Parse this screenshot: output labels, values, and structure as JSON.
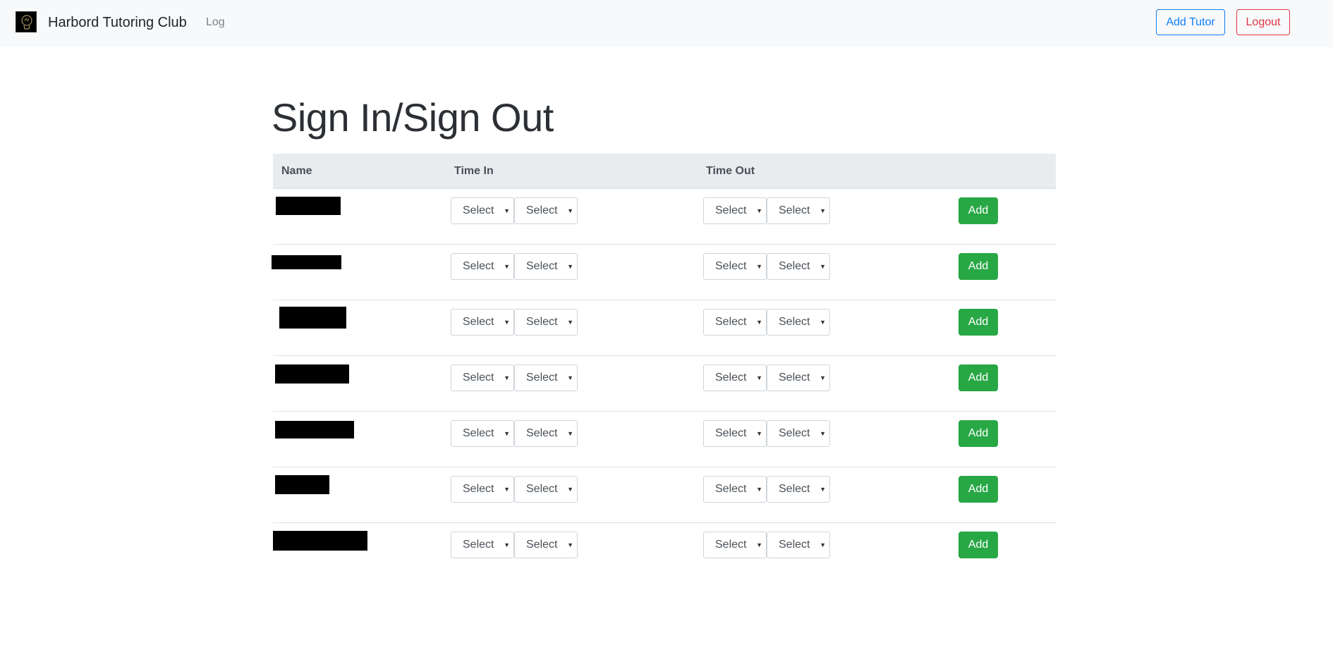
{
  "navbar": {
    "brand_name": "Harbord Tutoring Club",
    "log_link": "Log",
    "add_tutor_label": "Add Tutor",
    "logout_label": "Logout"
  },
  "page": {
    "title": "Sign In/Sign Out"
  },
  "table": {
    "headers": {
      "name": "Name",
      "time_in": "Time In",
      "time_out": "Time Out"
    },
    "rows": [
      {
        "name": "",
        "time_in_hour": "Select",
        "time_in_minute": "Select",
        "time_out_hour": "Select",
        "time_out_minute": "Select",
        "action": "Add"
      },
      {
        "name": "",
        "time_in_hour": "Select",
        "time_in_minute": "Select",
        "time_out_hour": "Select",
        "time_out_minute": "Select",
        "action": "Add"
      },
      {
        "name": "",
        "time_in_hour": "Select",
        "time_in_minute": "Select",
        "time_out_hour": "Select",
        "time_out_minute": "Select",
        "action": "Add"
      },
      {
        "name": "",
        "time_in_hour": "Select",
        "time_in_minute": "Select",
        "time_out_hour": "Select",
        "time_out_minute": "Select",
        "action": "Add"
      },
      {
        "name": "",
        "time_in_hour": "Select",
        "time_in_minute": "Select",
        "time_out_hour": "Select",
        "time_out_minute": "Select",
        "action": "Add"
      },
      {
        "name": "",
        "time_in_hour": "Select",
        "time_in_minute": "Select",
        "time_out_hour": "Select",
        "time_out_minute": "Select",
        "action": "Add"
      },
      {
        "name": "",
        "time_in_hour": "Select",
        "time_in_minute": "Select",
        "time_out_hour": "Select",
        "time_out_minute": "Select",
        "action": "Add"
      }
    ]
  },
  "colors": {
    "primary": "#0d7ef6",
    "danger": "#dc3545",
    "success": "#28a745",
    "navbar_bg": "#f8f9fa",
    "table_header_bg": "#e9ecef"
  },
  "icons": {
    "brand": "lightbulb-logo-icon",
    "select_caret": "caret-down-icon"
  }
}
